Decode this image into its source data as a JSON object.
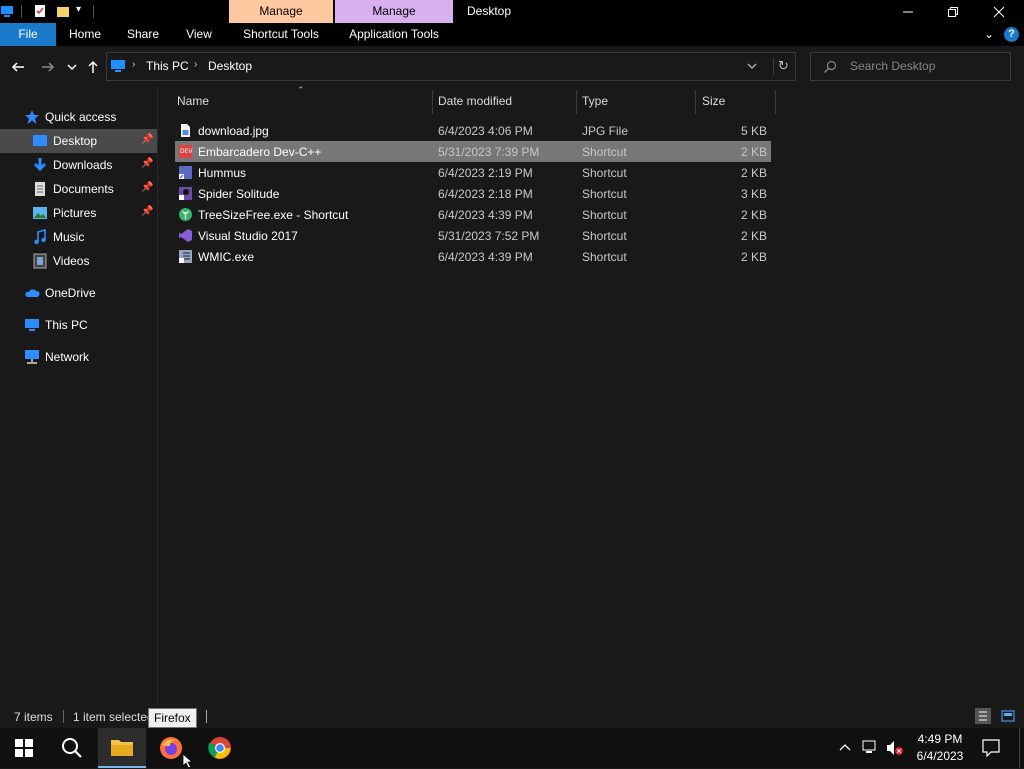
{
  "titlebar": {
    "ctx_tabs": [
      {
        "label": "Manage",
        "color": "#ffc8a0"
      },
      {
        "label": "Manage",
        "color": "#d8b0f0"
      }
    ],
    "title": "Desktop",
    "minimize_icon": "minimize-icon",
    "maximize_icon": "restore-icon",
    "close_icon": "close-icon"
  },
  "ribbon": {
    "tabs": [
      "File",
      "Home",
      "Share",
      "View",
      "Shortcut Tools",
      "Application Tools"
    ],
    "file_tab_color": "#1979ca"
  },
  "address": {
    "crumbs": [
      "This PC",
      "Desktop"
    ]
  },
  "search": {
    "placeholder": "Search Desktop"
  },
  "nav": {
    "items": [
      {
        "label": "Quick access",
        "icon": "star-icon"
      },
      {
        "label": "Desktop",
        "icon": "desktop-folder-icon",
        "pinned": true,
        "selected": true
      },
      {
        "label": "Downloads",
        "icon": "downloads-folder-icon",
        "pinned": true
      },
      {
        "label": "Documents",
        "icon": "documents-folder-icon",
        "pinned": true
      },
      {
        "label": "Pictures",
        "icon": "pictures-folder-icon",
        "pinned": true
      },
      {
        "label": "Music",
        "icon": "music-icon"
      },
      {
        "label": "Videos",
        "icon": "videos-icon"
      },
      {
        "label": "OneDrive",
        "icon": "onedrive-cloud-icon"
      },
      {
        "label": "This PC",
        "icon": "computer-icon"
      },
      {
        "label": "Network",
        "icon": "network-icon"
      }
    ]
  },
  "columns": [
    "Name",
    "Date modified",
    "Type",
    "Size"
  ],
  "files": [
    {
      "name": "download.jpg",
      "date": "6/4/2023 4:06 PM",
      "type": "JPG File",
      "size": "5 KB",
      "icon": "image-file-icon",
      "selected": false
    },
    {
      "name": "Embarcadero Dev-C++",
      "date": "5/31/2023 7:39 PM",
      "type": "Shortcut",
      "size": "2 KB",
      "icon": "devcpp-icon",
      "selected": true
    },
    {
      "name": "Hummus",
      "date": "6/4/2023 2:19 PM",
      "type": "Shortcut",
      "size": "2 KB",
      "icon": "shortcut-icon",
      "selected": false
    },
    {
      "name": "Spider Solitude",
      "date": "6/4/2023 2:18 PM",
      "type": "Shortcut",
      "size": "3 KB",
      "icon": "spider-solitaire-icon",
      "selected": false
    },
    {
      "name": "TreeSizeFree.exe - Shortcut",
      "date": "6/4/2023 4:39 PM",
      "type": "Shortcut",
      "size": "2 KB",
      "icon": "treesize-icon",
      "selected": false
    },
    {
      "name": "Visual Studio 2017",
      "date": "5/31/2023 7:52 PM",
      "type": "Shortcut",
      "size": "2 KB",
      "icon": "visual-studio-icon",
      "selected": false
    },
    {
      "name": "WMIC.exe",
      "date": "6/4/2023 4:39 PM",
      "type": "Shortcut",
      "size": "2 KB",
      "icon": "wmic-icon",
      "selected": false
    }
  ],
  "status": {
    "item_count": "7 items",
    "selection": "1 item selected"
  },
  "tooltip": "Firefox",
  "taskbar": {
    "apps": [
      "start-icon",
      "search-icon",
      "file-explorer-icon",
      "firefox-icon",
      "chrome-icon"
    ],
    "clock_time": "4:49 PM",
    "clock_date": "6/4/2023"
  }
}
